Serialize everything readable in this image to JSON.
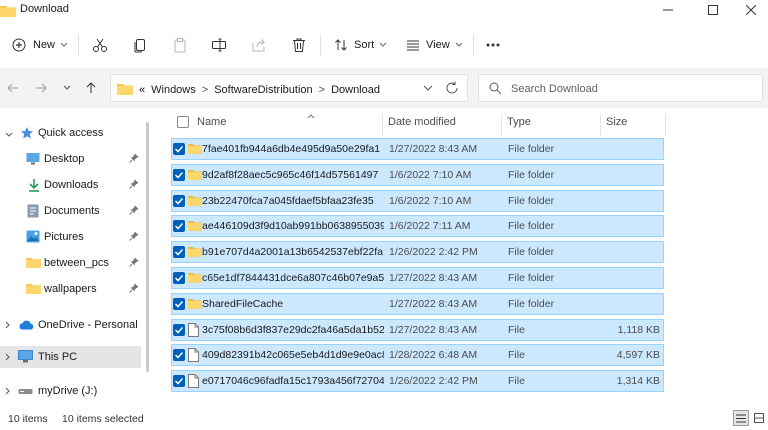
{
  "window": {
    "title": "Download"
  },
  "toolbar": {
    "new_label": "New",
    "sort_label": "Sort",
    "view_label": "View"
  },
  "address": {
    "overflow": "«",
    "crumbs": [
      "Windows",
      "SoftwareDistribution",
      "Download"
    ],
    "separator": ">"
  },
  "search": {
    "placeholder": "Search Download"
  },
  "sidebar": {
    "items": [
      {
        "label": "Quick access",
        "icon": "star-icon"
      },
      {
        "label": "Desktop",
        "icon": "desktop-icon"
      },
      {
        "label": "Downloads",
        "icon": "download-arrow-icon"
      },
      {
        "label": "Documents",
        "icon": "document-icon"
      },
      {
        "label": "Pictures",
        "icon": "picture-icon"
      },
      {
        "label": "between_pcs",
        "icon": "folder-icon"
      },
      {
        "label": "wallpapers",
        "icon": "folder-icon"
      },
      {
        "label": "OneDrive - Personal",
        "icon": "cloud-icon"
      },
      {
        "label": "This PC",
        "icon": "pc-icon"
      },
      {
        "label": "myDrive (J:)",
        "icon": "drive-icon"
      }
    ]
  },
  "columns": {
    "name": "Name",
    "date": "Date modified",
    "type": "Type",
    "size": "Size"
  },
  "files": [
    {
      "name": "7fae401fb944a6db4e495d9a50e29fa1",
      "date": "1/27/2022 8:43 AM",
      "type": "File folder",
      "size": "",
      "kind": "folder"
    },
    {
      "name": "9d2af8f28aec5c965c46f14d57561497",
      "date": "1/6/2022 7:10 AM",
      "type": "File folder",
      "size": "",
      "kind": "folder"
    },
    {
      "name": "23b22470fca7a045fdaef5bfaa23fe35",
      "date": "1/6/2022 7:10 AM",
      "type": "File folder",
      "size": "",
      "kind": "folder"
    },
    {
      "name": "ae446109d3f9d10ab991bb0638955039",
      "date": "1/6/2022 7:11 AM",
      "type": "File folder",
      "size": "",
      "kind": "folder"
    },
    {
      "name": "b91e707d4a2001a13b6542537ebf22fa",
      "date": "1/26/2022 2:42 PM",
      "type": "File folder",
      "size": "",
      "kind": "folder"
    },
    {
      "name": "c65e1df7844431dce6a807c46b07e9a5",
      "date": "1/27/2022 8:43 AM",
      "type": "File folder",
      "size": "",
      "kind": "folder"
    },
    {
      "name": "SharedFileCache",
      "date": "1/27/2022 8:43 AM",
      "type": "File folder",
      "size": "",
      "kind": "folder"
    },
    {
      "name": "3c75f08b6d3f837e29dc2fa46a5da1b52...",
      "date": "1/27/2022 8:43 AM",
      "type": "File",
      "size": "1,118 KB",
      "kind": "file"
    },
    {
      "name": "409d82391b42c065e5eb4d1d9e9e0ac8...",
      "date": "1/28/2022 6:48 AM",
      "type": "File",
      "size": "4,597 KB",
      "kind": "file"
    },
    {
      "name": "e0717046c96fadfa15c1793a456f72704e...",
      "date": "1/26/2022 2:42 PM",
      "type": "File",
      "size": "1,314 KB",
      "kind": "file"
    }
  ],
  "status": {
    "count": "10 items",
    "selected": "10 items selected"
  },
  "colors": {
    "selection": "#cce8ff",
    "selection_border": "#99d1ff",
    "checkbox": "#005fb8",
    "folder": "#f4c84f"
  }
}
